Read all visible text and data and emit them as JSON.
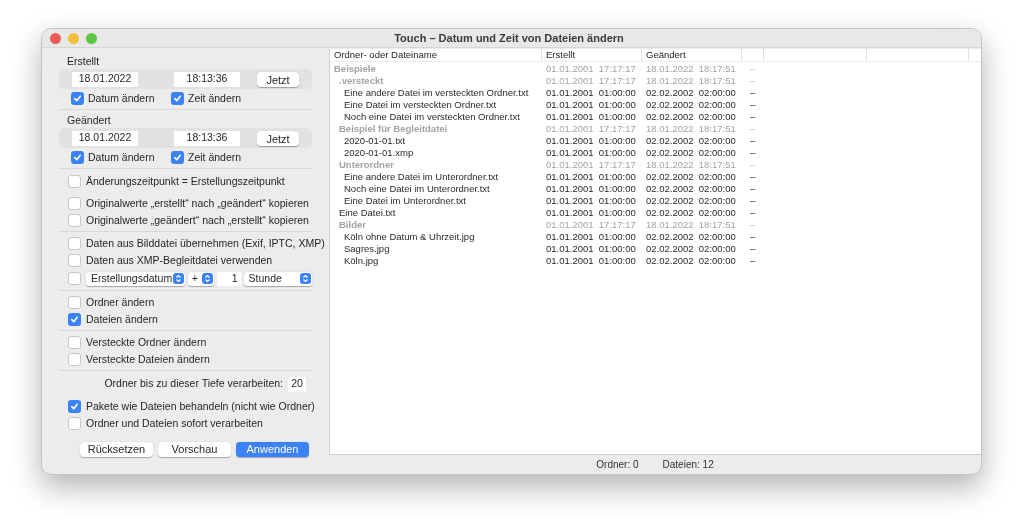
{
  "window": {
    "title": "Touch – Datum und Zeit von Dateien ändern"
  },
  "sections": [
    {
      "label": "Erstellt",
      "date": "18.01.2022",
      "time": "18:13:36",
      "now_button": "Jetzt",
      "checks": [
        {
          "label": "Datum ändern",
          "checked": true
        },
        {
          "label": "Zeit ändern",
          "checked": true
        }
      ]
    },
    {
      "label": "Geändert",
      "date": "18.01.2022",
      "time": "18:13:36",
      "now_button": "Jetzt",
      "checks": [
        {
          "label": "Datum ändern",
          "checked": true
        },
        {
          "label": "Zeit ändern",
          "checked": true
        }
      ]
    }
  ],
  "groups": [
    {
      "items": [
        {
          "kind": "checkbox",
          "label": "Änderungszeitpunkt = Erstellungszeitpunkt",
          "checked": false
        },
        {
          "kind": "checkbox",
          "label": "Originalwerte „erstellt“ nach „geändert“ kopieren",
          "checked": false
        },
        {
          "kind": "checkbox",
          "label": "Originalwerte „geändert“ nach „erstellt“ kopieren",
          "checked": false
        }
      ]
    },
    {
      "items": [
        {
          "kind": "checkbox",
          "label": "Daten aus Bilddatei übernehmen (Exif, IPTC, XMP)",
          "checked": false
        },
        {
          "kind": "checkbox",
          "label": "Daten aus XMP-Begleitdatei verwenden",
          "checked": false
        },
        {
          "kind": "offset",
          "checked": false,
          "field": "Erstellungsdatum",
          "sign": "+",
          "amount": "1",
          "unit": "Stunde"
        }
      ]
    },
    {
      "items": [
        {
          "kind": "checkbox",
          "label": "Ordner ändern",
          "checked": false
        },
        {
          "kind": "checkbox",
          "label": "Dateien ändern",
          "checked": true
        }
      ]
    },
    {
      "items": [
        {
          "kind": "checkbox",
          "label": "Versteckte Ordner ändern",
          "checked": false
        },
        {
          "kind": "checkbox",
          "label": "Versteckte Dateien ändern",
          "checked": false
        }
      ]
    },
    {
      "items": [
        {
          "kind": "number",
          "label": "Ordner bis zu dieser Tiefe verarbeiten:",
          "value": "20"
        },
        {
          "kind": "checkbox",
          "label": "Pakete wie Dateien behandeln (nicht wie Ordner)",
          "checked": true
        },
        {
          "kind": "checkbox",
          "label": "Ordner und Dateien sofort verarbeiten",
          "checked": false
        }
      ]
    }
  ],
  "buttons": [
    {
      "label": "Rücksetzen",
      "default": false
    },
    {
      "label": "Vorschau",
      "default": false
    },
    {
      "label": "Anwenden",
      "default": true
    }
  ],
  "table": {
    "columns": [
      "Ordner- oder Dateiname",
      "Erstellt",
      "Geändert"
    ],
    "rows": [
      {
        "kind": "folder",
        "name": "Beispiele",
        "created": "01.01.2001  17:17:17",
        "modified": "18.01.2022  18:17:51",
        "column_4": "–",
        "children": [
          {
            "kind": "folder",
            "name": ".versteckt",
            "created": "01.01.2001  17:17:17",
            "modified": "18.01.2022  18:17:51",
            "column_4": "–",
            "children": [
              {
                "kind": "file",
                "name": "Eine andere Datei im versteckten Ordner.txt",
                "created": "01.01.2001  01:00:00",
                "modified": "02.02.2002  02:00:00",
                "column_4": "–"
              },
              {
                "kind": "file",
                "name": "Eine Datei im versteckten Ordner.txt",
                "created": "01.01.2001  01:00:00",
                "modified": "02.02.2002  02:00:00",
                "column_4": "–"
              },
              {
                "kind": "file",
                "name": "Noch eine Datei im versteckten Ordner.txt",
                "created": "01.01.2001  01:00:00",
                "modified": "02.02.2002  02:00:00",
                "column_4": "–"
              }
            ]
          },
          {
            "kind": "folder",
            "name": "Beispiel für Begleitdatei",
            "created": "01.01.2001  17:17:17",
            "modified": "18.01.2022  18:17:51",
            "column_4": "–",
            "children": [
              {
                "kind": "file",
                "name": "2020-01-01.txt",
                "created": "01.01.2001  01:00:00",
                "modified": "02.02.2002  02:00:00",
                "column_4": "–"
              },
              {
                "kind": "file",
                "name": "2020-01-01.xmp",
                "created": "01.01.2001  01:00:00",
                "modified": "02.02.2002  02:00:00",
                "column_4": "–"
              }
            ]
          },
          {
            "kind": "folder",
            "name": "Unterordner",
            "created": "01.01.2001  17:17:17",
            "modified": "18.01.2022  18:17:51",
            "column_4": "–",
            "children": [
              {
                "kind": "file",
                "name": "Eine andere Datei im Unterordner.txt",
                "created": "01.01.2001  01:00:00",
                "modified": "02.02.2002  02:00:00",
                "column_4": "–"
              },
              {
                "kind": "file",
                "name": "Noch eine Datei im Unterordner.txt",
                "created": "01.01.2001  01:00:00",
                "modified": "02.02.2002  02:00:00",
                "column_4": "–"
              },
              {
                "kind": "file",
                "name": "Eine Datei im Unterordner.txt",
                "created": "01.01.2001  01:00:00",
                "modified": "02.02.2002  02:00:00",
                "column_4": "–"
              }
            ]
          },
          {
            "kind": "file",
            "name": "Eine Datei.txt",
            "created": "01.01.2001  01:00:00",
            "modified": "02.02.2002  02:00:00",
            "column_4": "–"
          },
          {
            "kind": "folder",
            "name": "Bilder",
            "created": "01.01.2001  17:17:17",
            "modified": "18.01.2022  18:17:51",
            "column_4": "–",
            "children": [
              {
                "kind": "file",
                "name": "Köln ohne Datum & Uhrzeit.jpg",
                "created": "01.01.2001  01:00:00",
                "modified": "02.02.2002  02:00:00",
                "column_4": "–"
              },
              {
                "kind": "file",
                "name": "Sagres.jpg",
                "created": "01.01.2001  01:00:00",
                "modified": "02.02.2002  02:00:00",
                "column_4": "–"
              },
              {
                "kind": "file",
                "name": "Köln.jpg",
                "created": "01.01.2001  01:00:00",
                "modified": "02.02.2002  02:00:00",
                "column_4": "–"
              }
            ]
          }
        ]
      }
    ]
  },
  "status_bar": {
    "folders": "Ordner: 0",
    "files": "Dateien: 12"
  }
}
